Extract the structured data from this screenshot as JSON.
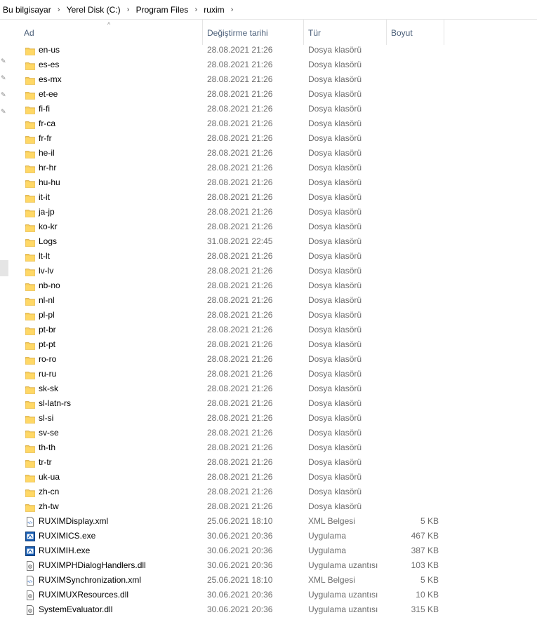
{
  "breadcrumb": [
    "Bu bilgisayar",
    "Yerel Disk (C:)",
    "Program Files",
    "ruxim"
  ],
  "columns": {
    "name": "Ad",
    "date": "Değiştirme tarihi",
    "type": "Tür",
    "size": "Boyut"
  },
  "files": [
    {
      "name": "en-us",
      "date": "28.08.2021 21:26",
      "type": "Dosya klasörü",
      "size": "",
      "icon": "folder-icon"
    },
    {
      "name": "es-es",
      "date": "28.08.2021 21:26",
      "type": "Dosya klasörü",
      "size": "",
      "icon": "folder-icon"
    },
    {
      "name": "es-mx",
      "date": "28.08.2021 21:26",
      "type": "Dosya klasörü",
      "size": "",
      "icon": "folder-icon"
    },
    {
      "name": "et-ee",
      "date": "28.08.2021 21:26",
      "type": "Dosya klasörü",
      "size": "",
      "icon": "folder-icon"
    },
    {
      "name": "fi-fi",
      "date": "28.08.2021 21:26",
      "type": "Dosya klasörü",
      "size": "",
      "icon": "folder-icon"
    },
    {
      "name": "fr-ca",
      "date": "28.08.2021 21:26",
      "type": "Dosya klasörü",
      "size": "",
      "icon": "folder-icon"
    },
    {
      "name": "fr-fr",
      "date": "28.08.2021 21:26",
      "type": "Dosya klasörü",
      "size": "",
      "icon": "folder-icon"
    },
    {
      "name": "he-il",
      "date": "28.08.2021 21:26",
      "type": "Dosya klasörü",
      "size": "",
      "icon": "folder-icon"
    },
    {
      "name": "hr-hr",
      "date": "28.08.2021 21:26",
      "type": "Dosya klasörü",
      "size": "",
      "icon": "folder-icon"
    },
    {
      "name": "hu-hu",
      "date": "28.08.2021 21:26",
      "type": "Dosya klasörü",
      "size": "",
      "icon": "folder-icon"
    },
    {
      "name": "it-it",
      "date": "28.08.2021 21:26",
      "type": "Dosya klasörü",
      "size": "",
      "icon": "folder-icon"
    },
    {
      "name": "ja-jp",
      "date": "28.08.2021 21:26",
      "type": "Dosya klasörü",
      "size": "",
      "icon": "folder-icon"
    },
    {
      "name": "ko-kr",
      "date": "28.08.2021 21:26",
      "type": "Dosya klasörü",
      "size": "",
      "icon": "folder-icon"
    },
    {
      "name": "Logs",
      "date": "31.08.2021 22:45",
      "type": "Dosya klasörü",
      "size": "",
      "icon": "folder-icon"
    },
    {
      "name": "lt-lt",
      "date": "28.08.2021 21:26",
      "type": "Dosya klasörü",
      "size": "",
      "icon": "folder-icon"
    },
    {
      "name": "lv-lv",
      "date": "28.08.2021 21:26",
      "type": "Dosya klasörü",
      "size": "",
      "icon": "folder-icon"
    },
    {
      "name": "nb-no",
      "date": "28.08.2021 21:26",
      "type": "Dosya klasörü",
      "size": "",
      "icon": "folder-icon"
    },
    {
      "name": "nl-nl",
      "date": "28.08.2021 21:26",
      "type": "Dosya klasörü",
      "size": "",
      "icon": "folder-icon"
    },
    {
      "name": "pl-pl",
      "date": "28.08.2021 21:26",
      "type": "Dosya klasörü",
      "size": "",
      "icon": "folder-icon"
    },
    {
      "name": "pt-br",
      "date": "28.08.2021 21:26",
      "type": "Dosya klasörü",
      "size": "",
      "icon": "folder-icon"
    },
    {
      "name": "pt-pt",
      "date": "28.08.2021 21:26",
      "type": "Dosya klasörü",
      "size": "",
      "icon": "folder-icon"
    },
    {
      "name": "ro-ro",
      "date": "28.08.2021 21:26",
      "type": "Dosya klasörü",
      "size": "",
      "icon": "folder-icon"
    },
    {
      "name": "ru-ru",
      "date": "28.08.2021 21:26",
      "type": "Dosya klasörü",
      "size": "",
      "icon": "folder-icon"
    },
    {
      "name": "sk-sk",
      "date": "28.08.2021 21:26",
      "type": "Dosya klasörü",
      "size": "",
      "icon": "folder-icon"
    },
    {
      "name": "sl-latn-rs",
      "date": "28.08.2021 21:26",
      "type": "Dosya klasörü",
      "size": "",
      "icon": "folder-icon"
    },
    {
      "name": "sl-si",
      "date": "28.08.2021 21:26",
      "type": "Dosya klasörü",
      "size": "",
      "icon": "folder-icon"
    },
    {
      "name": "sv-se",
      "date": "28.08.2021 21:26",
      "type": "Dosya klasörü",
      "size": "",
      "icon": "folder-icon"
    },
    {
      "name": "th-th",
      "date": "28.08.2021 21:26",
      "type": "Dosya klasörü",
      "size": "",
      "icon": "folder-icon"
    },
    {
      "name": "tr-tr",
      "date": "28.08.2021 21:26",
      "type": "Dosya klasörü",
      "size": "",
      "icon": "folder-icon"
    },
    {
      "name": "uk-ua",
      "date": "28.08.2021 21:26",
      "type": "Dosya klasörü",
      "size": "",
      "icon": "folder-icon"
    },
    {
      "name": "zh-cn",
      "date": "28.08.2021 21:26",
      "type": "Dosya klasörü",
      "size": "",
      "icon": "folder-icon"
    },
    {
      "name": "zh-tw",
      "date": "28.08.2021 21:26",
      "type": "Dosya klasörü",
      "size": "",
      "icon": "folder-icon"
    },
    {
      "name": "RUXIMDisplay.xml",
      "date": "25.06.2021 18:10",
      "type": "XML Belgesi",
      "size": "5 KB",
      "icon": "xml-file-icon"
    },
    {
      "name": "RUXIMICS.exe",
      "date": "30.06.2021 20:36",
      "type": "Uygulama",
      "size": "467 KB",
      "icon": "exe-file-icon"
    },
    {
      "name": "RUXIMIH.exe",
      "date": "30.06.2021 20:36",
      "type": "Uygulama",
      "size": "387 KB",
      "icon": "exe-file-icon"
    },
    {
      "name": "RUXIMPHDialogHandlers.dll",
      "date": "30.06.2021 20:36",
      "type": "Uygulama uzantısı",
      "size": "103 KB",
      "icon": "dll-file-icon"
    },
    {
      "name": "RUXIMSynchronization.xml",
      "date": "25.06.2021 18:10",
      "type": "XML Belgesi",
      "size": "5 KB",
      "icon": "xml-file-icon"
    },
    {
      "name": "RUXIMUXResources.dll",
      "date": "30.06.2021 20:36",
      "type": "Uygulama uzantısı",
      "size": "10 KB",
      "icon": "dll-file-icon"
    },
    {
      "name": "SystemEvaluator.dll",
      "date": "30.06.2021 20:36",
      "type": "Uygulama uzantısı",
      "size": "315 KB",
      "icon": "dll-file-icon"
    }
  ]
}
